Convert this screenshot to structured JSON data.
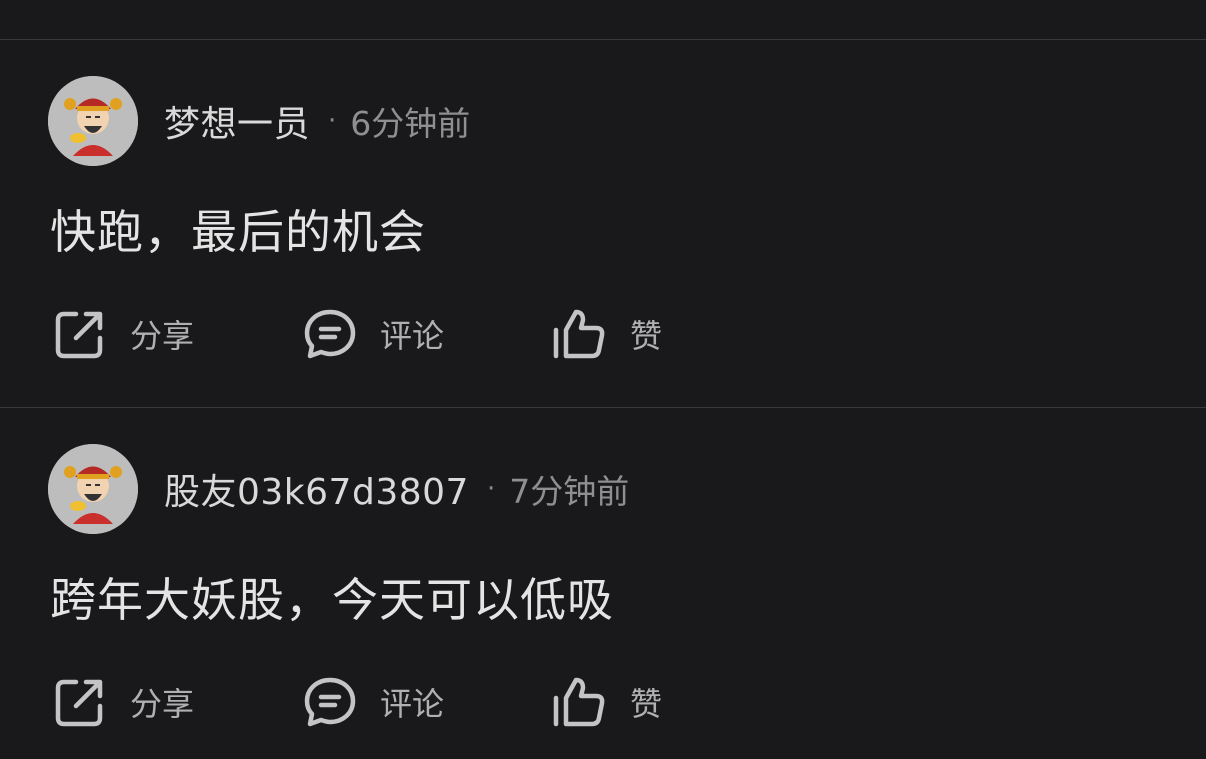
{
  "colors": {
    "background": "#19191b",
    "divider": "#3a3a3c",
    "primary_text": "#e4e4e4",
    "secondary_text": "#8f8f91",
    "icon": "#c4c4c6"
  },
  "posts": [
    {
      "username": "梦想一员",
      "separator": "·",
      "time": "6分钟前",
      "content": "快跑，最后的机会",
      "avatar_icon": "fortune-god-avatar",
      "actions": {
        "share": {
          "icon": "share-icon",
          "label": "分享"
        },
        "comment": {
          "icon": "comment-icon",
          "label": "评论"
        },
        "like": {
          "icon": "thumbs-up-icon",
          "label": "赞"
        }
      }
    },
    {
      "username": "股友03k67d3807",
      "separator": "·",
      "time": "7分钟前",
      "content": "跨年大妖股，今天可以低吸",
      "avatar_icon": "fortune-god-avatar",
      "actions": {
        "share": {
          "icon": "share-icon",
          "label": "分享"
        },
        "comment": {
          "icon": "comment-icon",
          "label": "评论"
        },
        "like": {
          "icon": "thumbs-up-icon",
          "label": "赞"
        }
      }
    }
  ]
}
